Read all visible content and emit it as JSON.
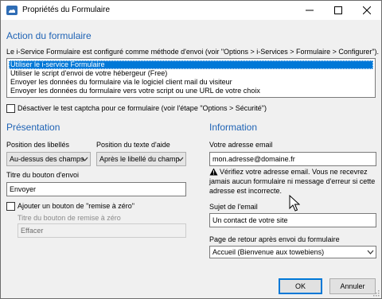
{
  "window": {
    "title": "Propriétés du Formulaire",
    "minimize_glyph": "—",
    "maximize_glyph": "☐",
    "close_glyph": "✕"
  },
  "action": {
    "heading": "Action du formulaire",
    "description": "Le i-Service Formulaire est configuré comme méthode d'envoi (voir \"Options > i-Services > Formulaire > Configurer\").",
    "options": [
      "Utiliser le i-service Formulaire",
      "Utiliser le script d'envoi de votre hébergeur (Free)",
      "Envoyer les données du formulaire via le logiciel client mail du visiteur",
      "Envoyer les données du formulaire vers votre script ou une URL de votre choix"
    ],
    "selected_index": 0,
    "captcha_label": "Désactiver le test captcha pour ce formulaire (voir l'étape \"Options > Sécurité\")",
    "captcha_checked": false
  },
  "presentation": {
    "heading": "Présentation",
    "labels_position_label": "Position des libellés",
    "labels_position_value": "Au-dessus des champs",
    "help_position_label": "Position du texte d'aide",
    "help_position_value": "Après le libellé du champ",
    "submit_title_label": "Titre du bouton d'envoi",
    "submit_title_value": "Envoyer",
    "reset_checkbox_label": "Ajouter un bouton de \"remise à zéro\"",
    "reset_checked": false,
    "reset_title_label": "Titre du bouton de remise à zéro",
    "reset_title_value": "Effacer"
  },
  "information": {
    "heading": "Information",
    "email_label": "Votre adresse email",
    "email_value": "mon.adresse@domaine.fr",
    "warning_text": "Vérifiez votre adresse email. Vous ne recevrez jamais aucun formulaire ni message d'erreur si cette adresse est incorrecte.",
    "subject_label": "Sujet de l'email",
    "subject_value": "Un contact de votre site",
    "return_page_label": "Page de retour après envoi du formulaire",
    "return_page_value": "Accueil (Bienvenue aux towebiens)"
  },
  "buttons": {
    "ok": "OK",
    "cancel": "Annuler"
  },
  "colors": {
    "heading_blue": "#1f63b5",
    "selection_blue": "#0078d7",
    "warning_icon": "#000000"
  }
}
